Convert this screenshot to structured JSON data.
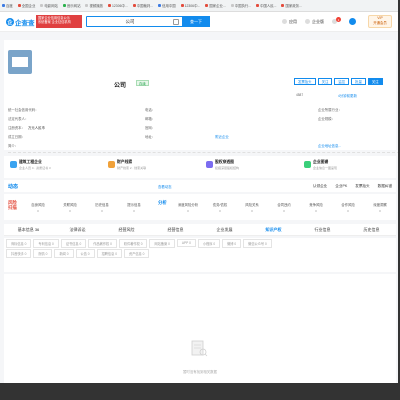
{
  "bookmarks": [
    {
      "label": "百度",
      "color": "blue"
    },
    {
      "label": "全国企业",
      "color": "red"
    },
    {
      "label": "电影网站",
      "color": ""
    },
    {
      "label": "音乐网站",
      "color": "green"
    },
    {
      "label": "视频播放",
      "color": ""
    },
    {
      "label": "12306中...",
      "color": "red"
    },
    {
      "label": "中国裁判...",
      "color": "red"
    },
    {
      "label": "信用中国",
      "color": "blue"
    },
    {
      "label": "12306中...",
      "color": "red"
    },
    {
      "label": "国家企业...",
      "color": "red"
    },
    {
      "label": "中国执行...",
      "color": ""
    },
    {
      "label": "中国人民...",
      "color": "red"
    },
    {
      "label": "国家政务...",
      "color": "red"
    }
  ],
  "header": {
    "logo_mark": "企",
    "logo_text": "企查查",
    "promo_line1": "国家企业信用信息公示",
    "promo_line2": "系统备案 企业征信机构",
    "search_value": "公司",
    "search_button": "查一下",
    "nav_app": "应用",
    "nav_enterprise": "企业版",
    "nav_msg_badge": "1",
    "vip_line1": "VIP",
    "vip_line2": "开通会员"
  },
  "company": {
    "name": "公司",
    "status_tag": "存续",
    "actions": [
      "发票抬头",
      "关注",
      "监控",
      "批量",
      "关注"
    ],
    "stats": "4587",
    "cert_link": "4分钟前更新",
    "credit_code_label": "统一社会信用代码：",
    "legal_label": "法定代表人：",
    "capital_label": "注册资本：",
    "capital_value": "万元人民币",
    "established_label": "成立日期：",
    "intro_label": "简介：",
    "phone_label": "电话：",
    "email_label": "邮箱：",
    "website_label": "官网：",
    "address_label": "地址：",
    "address_tail": "附近企业",
    "industry_label": "企业所属行业：",
    "scale_label": "企业规模：",
    "more_link": "企业地址信息..."
  },
  "features": [
    {
      "title": "建筑工程企业",
      "sub": "企业人员 4 · 资质证书 3",
      "color": "#3aa3f0"
    },
    {
      "title": "财产线索",
      "sub": "财产线索 2 · 线索关联",
      "color": "#f0a13a"
    },
    {
      "title": "股权穿透图",
      "sub": "挖掘深层股权结构",
      "color": "#7b6cf0"
    },
    {
      "title": "企业图谱",
      "sub": "企业信息一图呈现",
      "color": "#3acf7a"
    }
  ],
  "dynamics": {
    "title": "动态",
    "link": "查看动态",
    "right": [
      "认领企业",
      "企业PK",
      "发票抬头",
      "数据纠错"
    ]
  },
  "risk": {
    "label_left": "风险扫描",
    "label_right": "分析",
    "left_cells": [
      {
        "name": "自身风险",
        "num": "0"
      },
      {
        "name": "关联风险",
        "num": "0"
      },
      {
        "name": "历史信息",
        "num": "0"
      },
      {
        "name": "提示信息",
        "num": "0"
      }
    ],
    "right_cells": [
      {
        "name": "深度风险分析",
        "num": "0"
      },
      {
        "name": "债务/债权",
        "num": "0"
      },
      {
        "name": "风险关系",
        "num": "0"
      },
      {
        "name": "合同违约",
        "num": "0"
      },
      {
        "name": "竞争风险",
        "num": "0"
      },
      {
        "name": "合作风险",
        "num": "0"
      },
      {
        "name": "深度洞察",
        "num": "0"
      }
    ]
  },
  "tabs": [
    {
      "label": "基本信息 36",
      "active": false
    },
    {
      "label": "法律诉讼",
      "active": false
    },
    {
      "label": "经营风险",
      "active": false
    },
    {
      "label": "经营信息",
      "active": false
    },
    {
      "label": "企业发展",
      "active": false
    },
    {
      "label": "知识产权",
      "active": true
    },
    {
      "label": "行业信息",
      "active": false
    },
    {
      "label": "历史信息",
      "active": false
    }
  ],
  "subtabs_row1": [
    "商标信息 0",
    "专利信息 0",
    "证书信息 0",
    "作品著作权 0",
    "软件著作权 0",
    "网站备案 0",
    "APP 0",
    "小程序 0",
    "微博 0",
    "微信公众号 0"
  ],
  "subtabs_row2": [
    "抖音快手 0",
    "舆情 0",
    "新闻 0",
    "公告 0",
    "招聘信息 0",
    "资产信息 0"
  ],
  "empty_text": "暂时没有找到相关数据"
}
